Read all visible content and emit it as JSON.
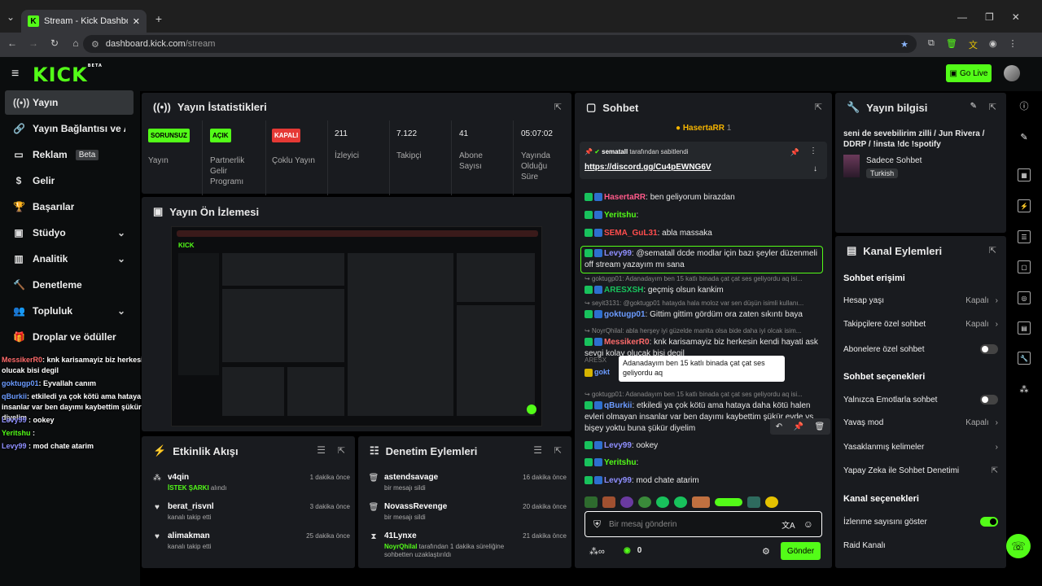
{
  "browser": {
    "tab_title": "Stream - Kick Dashboard",
    "url_host": "dashboard.kick.com",
    "url_path": "/stream"
  },
  "header": {
    "logo": "KICK",
    "logo_sup": "BETA",
    "go_live": "Go Live"
  },
  "sidebar": {
    "items": [
      {
        "label": "Yayın",
        "icon": "broadcast-icon"
      },
      {
        "label": "Yayın Bağlantısı ve Anahtarı",
        "icon": "link-icon"
      },
      {
        "label": "Reklam",
        "icon": "ad-icon",
        "badge": "Beta"
      },
      {
        "label": "Gelir",
        "icon": "money-icon"
      },
      {
        "label": "Başarılar",
        "icon": "trophy-icon"
      },
      {
        "label": "Stüdyo",
        "icon": "studio-icon"
      },
      {
        "label": "Analitik",
        "icon": "chart-icon"
      },
      {
        "label": "Denetleme",
        "icon": "hammer-icon"
      },
      {
        "label": "Topluluk",
        "icon": "users-icon"
      },
      {
        "label": "Droplar ve ödüller",
        "icon": "gift-icon"
      }
    ]
  },
  "overlay_chat": [
    {
      "name": "MessikerR0",
      "text": ": knk karisamayiz biz herkesin kendi hayati ask sevgi kolay olucak bisi degil",
      "color": "#ff6b6b"
    },
    {
      "name": "goktugp01",
      "text": ": Eyvallah canım",
      "color": "#6b9bff"
    },
    {
      "name": "qBurkii",
      "text": ": etkiledi ya çok kötü ama hataya daha kötü halen evleri olmayan insanlar var ben dayımı kaybettim şükür evde vs bişey yoktu buna şükür diyelim",
      "color": "#6b9bff"
    },
    {
      "name": "Levy99",
      "text": " : ookey",
      "color": "#8f8fff"
    },
    {
      "name": "Yeritshu",
      "text": " :",
      "color": "#53fc18"
    },
    {
      "name": "Levy99",
      "text": " : mod chate atarim",
      "color": "#8f8fff"
    }
  ],
  "stats": {
    "title": "Yayın İstatistikleri",
    "items": [
      {
        "badge": "SORUNSUZ",
        "label": "Yayın"
      },
      {
        "badge": "AÇIK",
        "label": "Partnerlik Gelir Programı"
      },
      {
        "badge": "KAPALI",
        "label": "Çoklu Yayın"
      },
      {
        "value": "211",
        "label": "İzleyici"
      },
      {
        "value": "7.122",
        "label": "Takipçi"
      },
      {
        "value": "41",
        "label": "Abone Sayısı"
      },
      {
        "value": "05:07:02",
        "label": "Yayında Olduğu Süre"
      }
    ]
  },
  "preview": {
    "title": "Yayın Ön İzlemesi"
  },
  "activity": {
    "title": "Etkinlik Akışı",
    "rows": [
      {
        "name": "v4qin",
        "sub_highlight": "İSTEK ŞARKI",
        "sub": " alındı",
        "time": "1 dakika önce"
      },
      {
        "name": "berat_risvnl",
        "sub": "kanalı takip etti",
        "time": "3 dakika önce"
      },
      {
        "name": "alimakman",
        "sub": "kanalı takip etti",
        "time": "25 dakika önce"
      }
    ]
  },
  "moderation": {
    "title": "Denetim Eylemleri",
    "rows": [
      {
        "name": "astendsavage",
        "sub": "bir mesajı sildi",
        "time": "16 dakika önce"
      },
      {
        "name": "NovassRevenge",
        "sub": "bir mesajı sildi",
        "time": "20 dakika önce"
      },
      {
        "name": "41Lynxe",
        "sub_highlight": "NoyrQhilal",
        "sub": " tarafından 1 dakika süreliğine sohbetten uzaklaştırıldı",
        "time": "21 dakika önce"
      }
    ]
  },
  "chat": {
    "title": "Sohbet",
    "top_user": "HasertaRR",
    "top_count": "1",
    "pinned_by": "sematall",
    "pinned_suffix": " tarafından sabitlendi",
    "pinned_link": "https://discord.gg/Cu4pEWNG6V",
    "messages": [
      {
        "name": "HasertaRR",
        "text": ": ben geliyorum birazdan",
        "color": "#ff5a8a"
      },
      {
        "name": "Yeritshu",
        "text": ":",
        "color": "#53fc18"
      },
      {
        "name": "SEMA_GuL31",
        "text": ": abla massaka",
        "color": "#ff4d4d"
      },
      {
        "name": "Levy99",
        "text": ": @sematall dcde modlar için bazı şeyler düzenmeli off stream yazayım mı sana",
        "color": "#8f8fff"
      },
      {
        "reply": "goktugp01: Adanadayım ben 15 katlı binada çat çat ses geliyordu aq isi...",
        "name": "ARESXSH",
        "text": ": geçmiş olsun kankim",
        "color": "#18c25c"
      },
      {
        "reply": "seyit3131: @goktugp01 hatayda hala moloz var sen düşün isimli kullanı...",
        "name": "goktugp01",
        "text": ": Gittim gittim gördüm ora zaten sıkıntı baya",
        "color": "#6b9bff"
      },
      {
        "reply": "NoyrQhilal: abla herşey iyi güzelde manita olsa bide daha iyi olcak isim...",
        "name": "MessikerR0",
        "text": ": knk karisamayiz biz herkesin kendi hayati ask sevgi kolay olucak bisi degil",
        "color": "#ff6b6b"
      },
      {
        "reply": "goktugp01: Adanadayım ben 15 katlı binada çat çat ses geliyordu aq isi...",
        "name": "qBurkii",
        "text": ": etkiledi ya çok kötü ama hataya daha kötü halen evleri olmayan insanlar var ben dayımı kaybettim şükür evde vs bişey yoktu buna şükür diyelim",
        "color": "#6b9bff"
      },
      {
        "name": "Levy99",
        "text": ": ookey",
        "color": "#8f8fff"
      },
      {
        "name": "Yeritshu",
        "text": ":",
        "color": "#53fc18"
      },
      {
        "name": "Levy99",
        "text": ": mod chate atarim",
        "color": "#8f8fff"
      }
    ],
    "hidden_line_prefix": "ARESX",
    "hidden_line_name": "gokt",
    "tooltip": "Adanadayım ben 15 katlı binada çat çat ses geliyordu aq",
    "input_placeholder": "Bir mesaj gönderin",
    "points": "0",
    "send": "Gönder"
  },
  "stream_info": {
    "title": "Yayın bilgisi",
    "stream_title": "seni de sevebilirim zilli / Jun Rivera / DDRP / !insta !dc !spotify",
    "category": "Sadece Sohbet",
    "language": "Turkish"
  },
  "channel_actions": {
    "title": "Kanal Eylemleri",
    "chat_access": "Sohbet erişimi",
    "age": {
      "label": "Hesap yaşı",
      "value": "Kapalı"
    },
    "followers": {
      "label": "Takipçilere özel sohbet",
      "value": "Kapalı"
    },
    "subs": {
      "label": "Abonelere özel sohbet",
      "on": false
    },
    "chat_options": "Sohbet seçenekleri",
    "emotes": {
      "label": "Yalnızca Emotlarla sohbet",
      "on": false
    },
    "slow": {
      "label": "Yavaş mod",
      "value": "Kapalı"
    },
    "banned_words": "Yasaklanmış kelimeler",
    "ai_mod": "Yapay Zeka ile Sohbet Denetimi",
    "channel_options": "Kanal seçenekleri",
    "viewer_count": {
      "label": "İzlenme sayısını göster",
      "on": true
    },
    "raid": "Raid Kanalı"
  },
  "colors": {
    "accent": "#53fc18",
    "panel": "#191b1f",
    "bg": "#000000"
  }
}
